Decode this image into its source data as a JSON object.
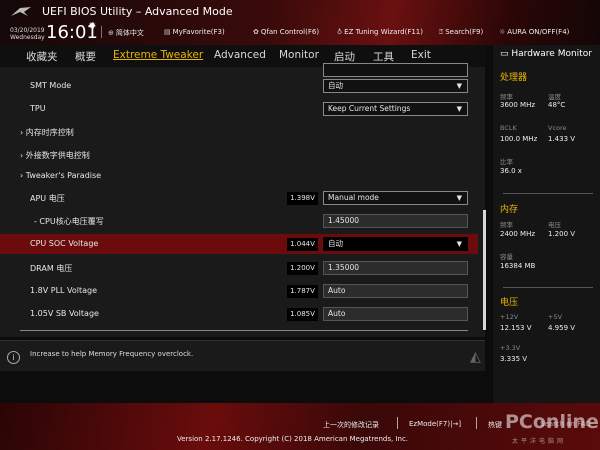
{
  "header": {
    "title": "UEFI BIOS Utility – Advanced Mode",
    "date": "03/20/2019",
    "day": "Wednesday",
    "time": "16:01",
    "tools": [
      {
        "icon": "globe-icon",
        "label": "简体中文"
      },
      {
        "icon": "favorite-icon",
        "label": "MyFavorite(F3)"
      },
      {
        "icon": "fan-icon",
        "label": "Qfan Control(F6)"
      },
      {
        "icon": "bulb-icon",
        "label": "EZ Tuning Wizard(F11)"
      },
      {
        "icon": "question-icon",
        "label": "Search(F9)"
      },
      {
        "icon": "aura-icon",
        "label": "AURA ON/OFF(F4)"
      }
    ]
  },
  "tabs": [
    "收藏夹",
    "概要",
    "Extreme Tweaker",
    "Advanced",
    "Monitor",
    "启动",
    "工具",
    "Exit"
  ],
  "rows": [
    {
      "label": "SMT Mode",
      "value": "自动"
    },
    {
      "label": "TPU",
      "value": "Keep Current Settings"
    },
    {
      "label": "内存时序控制"
    },
    {
      "label": "外接数字供电控制"
    },
    {
      "label": "Tweaker's Paradise"
    },
    {
      "label": "APU 电压",
      "badge": "1.398V",
      "value": "Manual mode"
    },
    {
      "label": "- CPU核心电压覆写",
      "value": "1.45000"
    },
    {
      "label": "CPU SOC Voltage",
      "badge": "1.044V",
      "value": "自动"
    },
    {
      "label": "DRAM 电压",
      "badge": "1.200V",
      "value": "1.35000"
    },
    {
      "label": "1.8V PLL Voltage",
      "badge": "1.787V",
      "value": "Auto"
    },
    {
      "label": "1.05V SB Voltage",
      "badge": "1.085V",
      "value": "Auto"
    }
  ],
  "help": "Increase to help Memory Frequency overclock.",
  "hw": {
    "title": "Hardware Monitor",
    "cpu": {
      "title": "处理器",
      "freq_k": "频率",
      "freq": "3600 MHz",
      "temp_k": "温度",
      "temp": "48°C",
      "bclk_k": "BCLK",
      "bclk": "100.0 MHz",
      "vcore_k": "Vcore",
      "vcore": "1.433 V",
      "ratio_k": "比率",
      "ratio": "36.0 x"
    },
    "mem": {
      "title": "内存",
      "freq_k": "频率",
      "freq": "2400 MHz",
      "volt_k": "电压",
      "volt": "1.200 V",
      "cap_k": "容量",
      "cap": "16384 MB"
    },
    "volt": {
      "title": "电压",
      "v12_k": "+12V",
      "v12": "12.153 V",
      "v5_k": "+5V",
      "v5": "4.959 V",
      "v33_k": "+3.3V",
      "v33": "3.335 V"
    }
  },
  "footer": {
    "last": "上一次的修改记录",
    "ez": "EzMode(F7)|→]",
    "hot": "热键",
    "faq": "Search on FAQ",
    "copyright": "Version 2.17.1246. Copyright (C) 2018 American Megatrends, Inc.",
    "watermark": "PConline",
    "watermark_sub": "太平洋电脑网"
  },
  "colors": {
    "accent": "#e8b700",
    "highlight": "#6b0b0b"
  }
}
